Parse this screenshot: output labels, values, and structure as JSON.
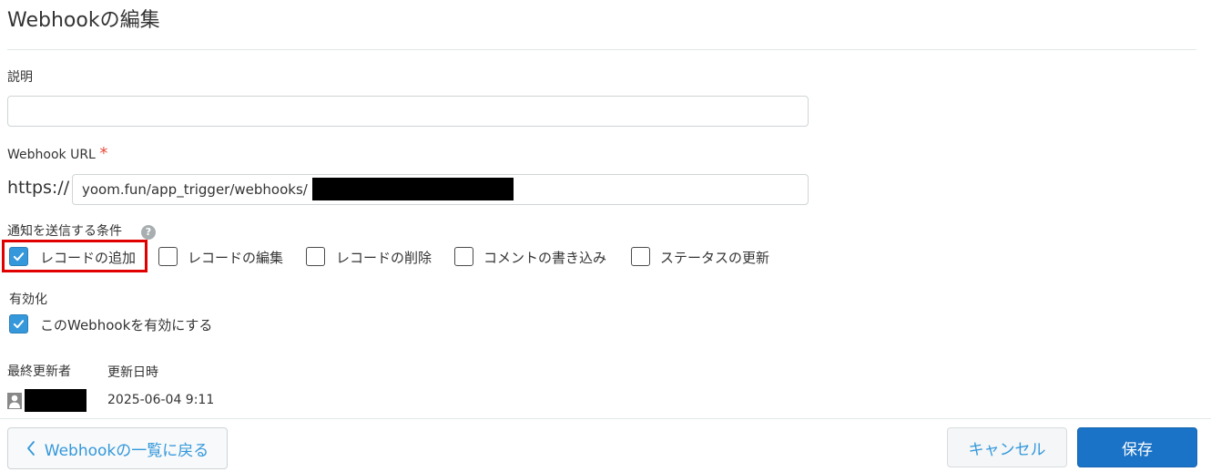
{
  "header": {
    "title": "Webhookの編集"
  },
  "form": {
    "description": {
      "label": "説明",
      "value": "",
      "placeholder": ""
    },
    "webhook_url": {
      "label": "Webhook URL",
      "required_mark": "*",
      "prefix": "https://",
      "value": "yoom.fun/app_trigger/webhooks/"
    },
    "conditions": {
      "label": "通知を送信する条件",
      "help_icon": "?",
      "options": [
        {
          "label": "レコードの追加",
          "checked": true
        },
        {
          "label": "レコードの編集",
          "checked": false
        },
        {
          "label": "レコードの削除",
          "checked": false
        },
        {
          "label": "コメントの書き込み",
          "checked": false
        },
        {
          "label": "ステータスの更新",
          "checked": false
        }
      ]
    },
    "enabled": {
      "label": "有効化",
      "checkbox_label": "このWebhookを有効にする",
      "checked": true
    }
  },
  "meta": {
    "last_updated_by_label": "最終更新者",
    "updated_at_label": "更新日時",
    "updated_at_value": "2025-06-04 9:11"
  },
  "footer": {
    "back_button": "Webhookの一覧に戻る",
    "cancel_button": "キャンセル",
    "save_button": "保存"
  },
  "colors": {
    "accent": "#3498db",
    "primary_button": "#1a73c6",
    "highlight_box": "#e00000",
    "required": "#e74c3c"
  }
}
